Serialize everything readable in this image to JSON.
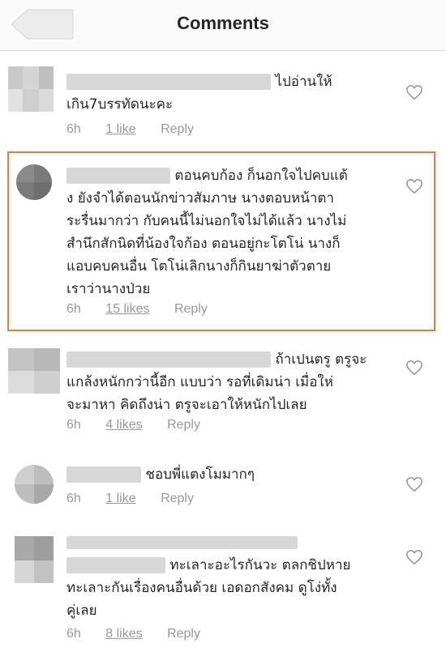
{
  "header": {
    "title": "Comments"
  },
  "comments": [
    {
      "text_line1": "ไปอ่านให้",
      "text_line2": "เกิน7บรรทัดนะคะ",
      "time": "6h",
      "likes": "1 like",
      "reply": "Reply"
    },
    {
      "text_line1": "ตอนคบก้อง ก็นอกใจไปคบแต้",
      "text_line2": "ง ยังจำได้ตอนนักข่าวสัมภาษ นางตอบหน้าตา",
      "text_line3": "ระรื่นมากว่า กับคนนี้ไม่นอกใจไม่ได้แล้ว นางไม่",
      "text_line4": "สำนึกสักนิดที่น้องใจก้อง ตอนอยู่กะโตโน่ นางก็",
      "text_line5": "แอบคบคนอื่น โตโน่เลิกนางก็กินยาฆ่าตัวตาย",
      "text_line6": "เราว่านางป่วย",
      "time": "6h",
      "likes": "15 likes",
      "reply": "Reply"
    },
    {
      "text_line1": "ถ้าเปนตรู ตรูจะ",
      "text_line2": "แกล้งหนักกว่านี้อีก แบบว่า รอที่เดิมน่า เมื่อให่",
      "text_line3": "จะมาหา คิดถึงน่า ตรูจะเอาให้หนักไปเลย",
      "time": "6h",
      "likes": "4 likes",
      "reply": "Reply"
    },
    {
      "text_line1": "ชอบพี่แตงโมมากๆ",
      "time": "6h",
      "likes": "1 like",
      "reply": "Reply"
    },
    {
      "text_line1": "ทะเลาะอะไรกันวะ ตลกชิปหาย",
      "text_line2": "ทะเลาะกันเรื่องคนอื่นด้วย เอดอกสังคม ดูโง่ทั้ง",
      "text_line3": "คู่เลย",
      "time": "6h",
      "likes": "8 likes",
      "reply": "Reply"
    }
  ],
  "colors": {
    "highlight": "#ef7a3c",
    "meta": "#999999",
    "text": "#262626"
  }
}
